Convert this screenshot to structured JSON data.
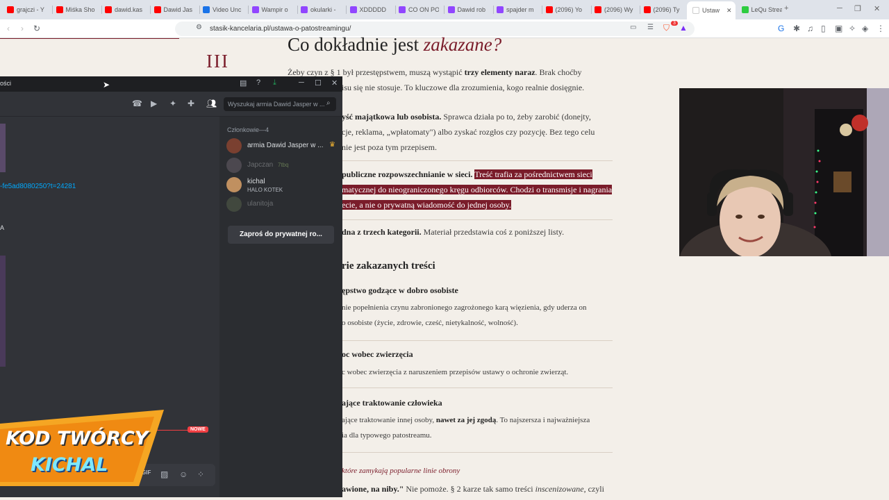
{
  "browser": {
    "tabs": [
      {
        "label": "grajczi - Y",
        "color": "#ff0000"
      },
      {
        "label": "Miśka Sho",
        "color": "#ff0000"
      },
      {
        "label": "dawid.kas",
        "color": "#ff0000"
      },
      {
        "label": "Dawid Jas",
        "color": "#ff0000"
      },
      {
        "label": "Video Unc",
        "color": "#1a73e8"
      },
      {
        "label": "Wampir o",
        "color": "#9146ff"
      },
      {
        "label": "okularki -",
        "color": "#9146ff"
      },
      {
        "label": "XDDDDD",
        "color": "#9146ff"
      },
      {
        "label": "CO ON PO",
        "color": "#9146ff"
      },
      {
        "label": "Dawid rob",
        "color": "#9146ff"
      },
      {
        "label": "spajder m",
        "color": "#9146ff"
      },
      {
        "label": "(2096) Yo",
        "color": "#ff0000"
      },
      {
        "label": "(2096) Wy",
        "color": "#ff0000"
      },
      {
        "label": "(2096) Ty",
        "color": "#ff0000"
      },
      {
        "label": "Ustaw",
        "color": "#ffffff",
        "active": true
      },
      {
        "label": "LeQu Strea",
        "color": "#2ecc40"
      }
    ],
    "url": "stasik-kancelaria.pl/ustawa-o-patostreamingu/",
    "extension_badge": "3"
  },
  "article": {
    "section_numeral": "III",
    "heading_prefix": "Co dokładnie jest ",
    "heading_em": "zakazane?",
    "intro_a": "Żeby czyn z § 1 był przestępstwem, muszą wystąpić ",
    "intro_b": "trzy elementy naraz",
    "intro_c": ". Brak choćby",
    "intro_line2": "isu się nie stosuje. To kluczowe dla zrozumienia, kogo realnie dosięgnie.",
    "el1_b": "yść majątkowa lub osobista.",
    "el1_c": " Sprawca działa po to, żeby zarobić (donejty,",
    "el1_line2": "cje, reklama, „wpłatomaty\") albo zyskać rozgłos czy pozycję. Bez tego celu",
    "el1_line3": "nie jest poza tym przepisem.",
    "el2_b": "publiczne rozpowszechnianie w sieci.",
    "el2_hl1": "Treść trafia za pośrednictwem sieci",
    "el2_hl2": "matycznej do nieograniczonego kręgu odbiorców. Chodzi o transmisje i nagrania",
    "el2_hl3": "ecie, a nie o prywatną wiadomość do jednej osoby.",
    "el3_b": "dna z trzech kategorii.",
    "el3_c": " Materiał przedstawia coś z poniższej listy.",
    "categories_heading": "rie zakazanych treści",
    "cat1_title": "ępstwo godzące w dobro osobiste",
    "cat1_line1": "nie popełnienia czynu zabronionego zagrożonego karą więzienia, gdy uderza on",
    "cat1_line2": "o osobiste (życie, zdrowie, cześć, nietykalność, wolność).",
    "cat2_title": "oc wobec zwierzęcia",
    "cat2_line1": "c wobec zwierzęcia z naruszeniem przepisów ustawy o ochronie zwierząt.",
    "cat3_title": "ające traktowanie człowieka",
    "cat3_line1a": "ające traktowanie innej osoby, ",
    "cat3_line1b": "nawet za jej zgodą",
    "cat3_line1c": ". To najszersza i najważniejsza",
    "cat3_line2": "ia dla typowego patostreamu.",
    "defense_line": "które zamykają popularne linie obrony",
    "bottom_b": "awione, na niby.\"",
    "bottom_c": " Nie pomoże. § 2 karze tak samo treści ",
    "bottom_em": "inscenizowane",
    "bottom_d": ", czyli"
  },
  "discord": {
    "window_title": "ości",
    "search_placeholder": "Wyszukaj armia Dawid Jasper w ...",
    "members_header": "Członkowie—4",
    "members": [
      {
        "name": "armia Dawid Jasper w ...",
        "status": "",
        "dim": false
      },
      {
        "name": "Japczan",
        "status": "7tbq",
        "dim": true
      },
      {
        "name": "kichal",
        "status": "HALO KOTEK",
        "dim": false
      },
      {
        "name": "ulanitoja",
        "status": "",
        "dim": true
      }
    ],
    "invite_label": "Zaproś do prywatnej ro...",
    "link_text": "-fe5ad8080250?t=24281",
    "letter_a": "A",
    "new_badge": "NOWE"
  },
  "promo": {
    "line1": "KOD TWÓRCY",
    "line2": "KICHAL"
  }
}
